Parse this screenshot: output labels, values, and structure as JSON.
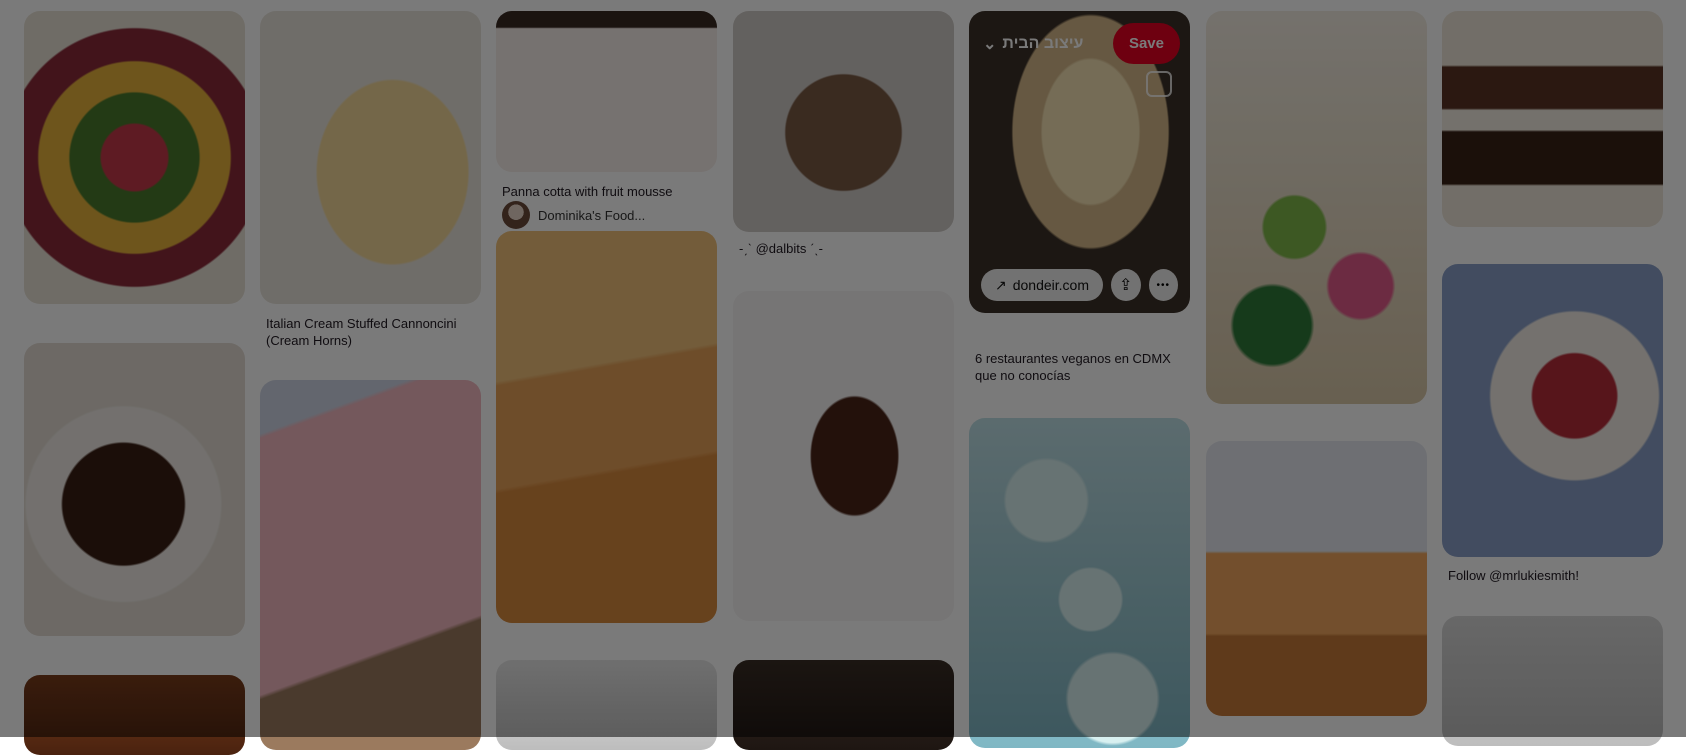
{
  "pins": {
    "cannoncini_title": "Italian Cream Stuffed Cannoncini (Cream Horns)",
    "panna_cotta_title": "Panna cotta with fruit mousse",
    "panna_cotta_author": "Dominika's Food...",
    "dalbits_caption": "-ˏˋ @dalbits ˊˎ-",
    "hover": {
      "board_name": "עיצוב הבית",
      "save_label": "Save",
      "link_domain": "dondeir.com",
      "title": "6 restaurantes veganos en CDMX que no conocías"
    },
    "mrlukie_caption": "Follow @mrlukiesmith!"
  },
  "icons": {
    "arrow": "↗",
    "chevron": "⌄",
    "more": "•••",
    "share": "⇪"
  }
}
